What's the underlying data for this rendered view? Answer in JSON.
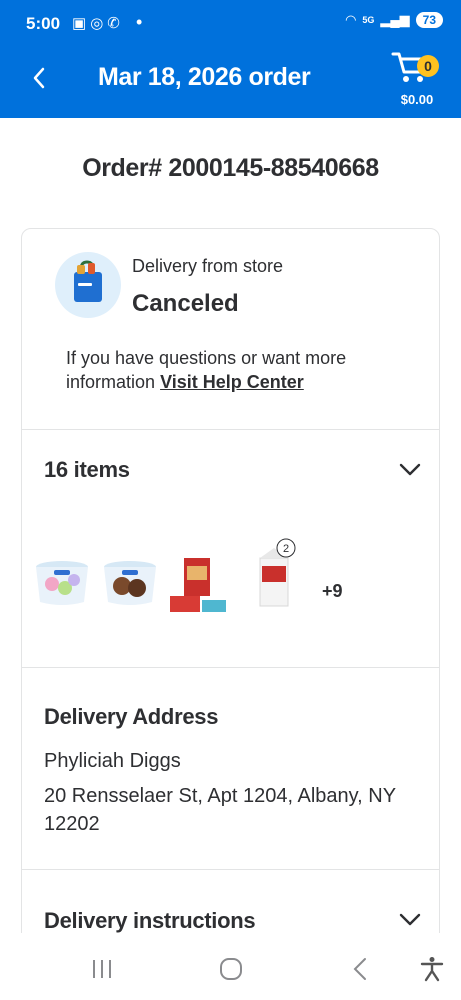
{
  "status_bar": {
    "time": "5:00",
    "battery": "73",
    "left_icons": [
      "screenshot-icon",
      "nfc-icon",
      "call-icon"
    ],
    "right_icons": [
      "hotspot-icon",
      "5g-icon",
      "signal-icon"
    ]
  },
  "header": {
    "title": "Mar 18, 2026 order",
    "cart_count": "0",
    "cart_total": "$0.00",
    "colors": {
      "bar": "#0071dc",
      "badge": "#ffc220"
    }
  },
  "order": {
    "number": "Order# 2000145-88540668"
  },
  "status_section": {
    "delivery_type": "Delivery from store",
    "status": "Canceled",
    "help_text": "If you have questions or want more information",
    "help_link": "Visit Help Center"
  },
  "items_section": {
    "count_label": "16 items",
    "thumbnails": [
      {
        "name": "ice-cream-tub-rainbow",
        "badge": ""
      },
      {
        "name": "ice-cream-tub-chocolate",
        "badge": ""
      },
      {
        "name": "bagel-bites-box",
        "badge": ""
      },
      {
        "name": "milk-carton",
        "badge": "2"
      }
    ],
    "more_label": "+9"
  },
  "address_section": {
    "title": "Delivery Address",
    "name": "Phyliciah Diggs",
    "line": "20 Rensselaer St, Apt 1204, Albany, NY 12202"
  },
  "instructions_section": {
    "title": "Delivery instructions"
  },
  "nav_bar": {
    "buttons": [
      "recents-icon",
      "home-icon",
      "back-icon",
      "accessibility-icon"
    ]
  }
}
